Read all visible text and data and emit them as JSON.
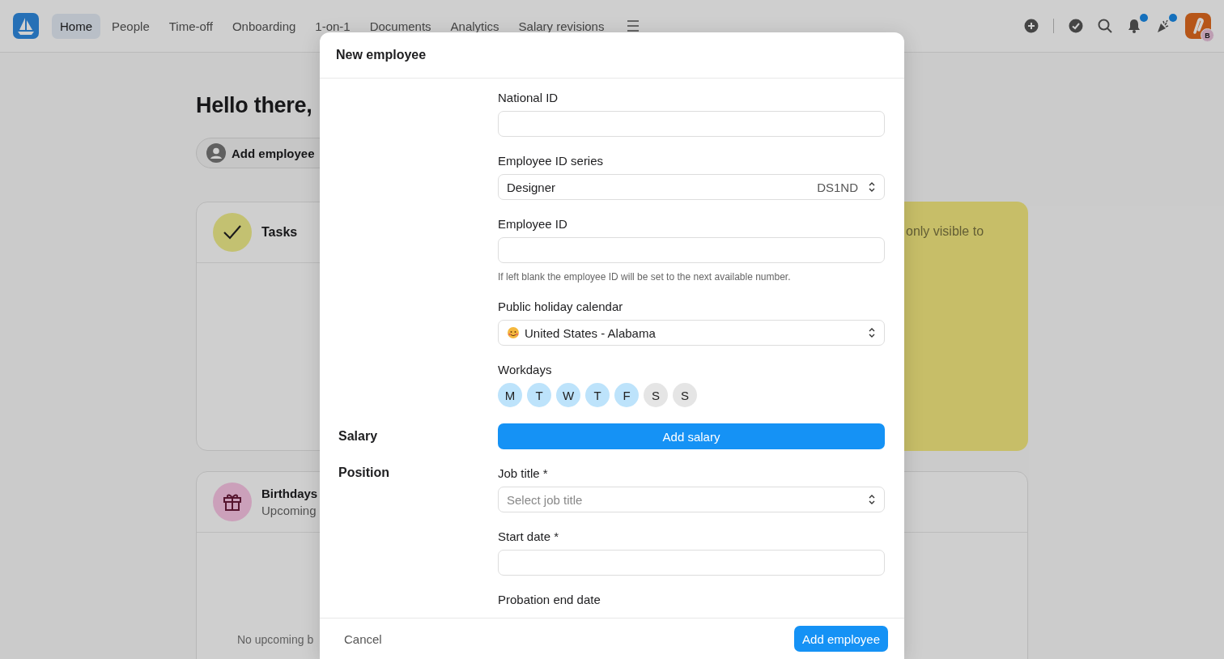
{
  "nav": {
    "tabs": [
      {
        "label": "Home",
        "selected": true
      },
      {
        "label": "People",
        "selected": false
      },
      {
        "label": "Time-off",
        "selected": false
      },
      {
        "label": "Onboarding",
        "selected": false
      },
      {
        "label": "1-on-1",
        "selected": false
      },
      {
        "label": "Documents",
        "selected": false
      },
      {
        "label": "Analytics",
        "selected": false
      },
      {
        "label": "Salary revisions",
        "selected": false
      }
    ],
    "notifications_unread": true,
    "updates_unread": true,
    "avatar_badge": "B"
  },
  "page": {
    "greeting": "Hello there,",
    "add_employee_button": "Add employee",
    "tasks_title": "Tasks",
    "note_text": "only visible to",
    "birthdays_title": "Birthdays",
    "birthdays_subtitle": "Upcoming",
    "birthdays_empty": "No upcoming b"
  },
  "modal": {
    "title": "New employee",
    "sections": [
      {
        "fields": [
          {
            "kind": "text",
            "label": "National ID"
          },
          {
            "kind": "select",
            "label": "Employee ID series",
            "value": "Designer",
            "suffix": "DS1ND"
          },
          {
            "kind": "text",
            "label": "Employee ID",
            "help": "If left blank the employee ID will be set to the next available number."
          },
          {
            "kind": "select",
            "label": "Public holiday calendar",
            "value": "United States - Alabama",
            "emoji": true
          },
          {
            "kind": "days",
            "label": "Workdays",
            "days": [
              {
                "label": "M",
                "selected": true
              },
              {
                "label": "T",
                "selected": true
              },
              {
                "label": "W",
                "selected": true
              },
              {
                "label": "T",
                "selected": true
              },
              {
                "label": "F",
                "selected": true
              },
              {
                "label": "S",
                "selected": false
              },
              {
                "label": "S",
                "selected": false
              }
            ]
          }
        ]
      },
      {
        "label": "Salary",
        "fields": [
          {
            "kind": "button",
            "label": "Add salary"
          }
        ]
      },
      {
        "label": "Position",
        "fields": [
          {
            "kind": "select",
            "label": "Job title *",
            "placeholder": "Select job title"
          },
          {
            "kind": "text",
            "label": "Start date *"
          },
          {
            "kind": "label",
            "label": "Probation end date"
          }
        ]
      }
    ],
    "cancel_button": "Cancel",
    "submit_button": "Add employee"
  }
}
